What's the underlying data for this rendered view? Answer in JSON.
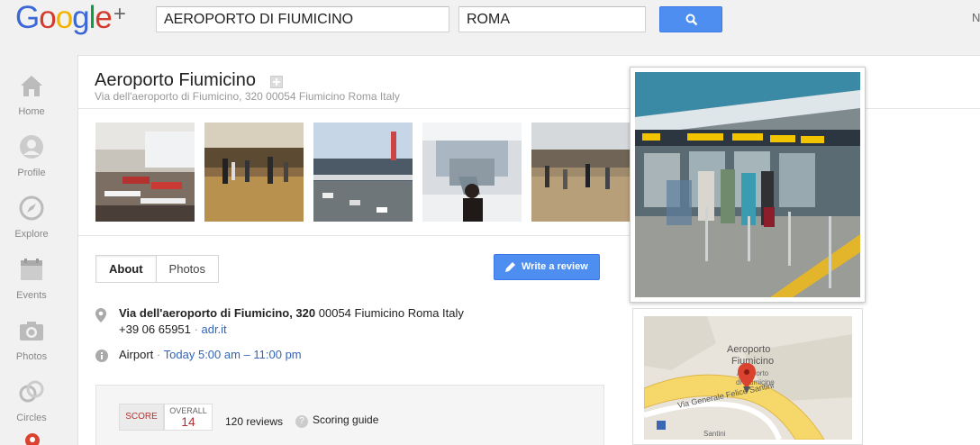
{
  "header": {
    "logo_text": "Google+",
    "search_query": "AEROPORTO DI FIUMICINO",
    "search_location": "ROMA",
    "search_icon": "search-icon",
    "top_right_text": "N"
  },
  "nav": {
    "items": [
      {
        "label": "Home",
        "icon": "home-icon"
      },
      {
        "label": "Profile",
        "icon": "profile-icon"
      },
      {
        "label": "Explore",
        "icon": "compass-icon"
      },
      {
        "label": "Events",
        "icon": "calendar-icon"
      },
      {
        "label": "Photos",
        "icon": "camera-icon"
      },
      {
        "label": "Circles",
        "icon": "circles-icon"
      }
    ]
  },
  "place": {
    "title": "Aeroporto Fiumicino",
    "subtitle": "Via dell'aeroporto di Fiumicino, 320 00054 Fiumicino Roma Italy"
  },
  "tabs": {
    "about": "About",
    "photos": "Photos"
  },
  "actions": {
    "write_review": "Write a review"
  },
  "info": {
    "address_bold": "Via dell'aeroporto di Fiumicino, 320",
    "address_rest": "00054 Fiumicino Roma Italy",
    "phone": "+39 06 65951",
    "separator": "·",
    "website": "adr.it",
    "category": "Airport",
    "hours": "Today 5:00 am – 11:00 pm"
  },
  "score": {
    "label": "SCORE",
    "overall_label": "OVERALL",
    "overall_value": "14",
    "reviews": "120 reviews",
    "guide": "Scoring guide"
  },
  "map": {
    "place_name_line1": "Aeroporto",
    "place_name_line2": "Fiumicino",
    "sub_line1": "Aeroporto",
    "sub_line2": "di Fiumicino",
    "road": "Via Generale Felice Santini",
    "road2": "Santini"
  },
  "colors": {
    "accent_blue": "#4d8ef0",
    "link_blue": "#3465b8",
    "score_red": "#b03434"
  }
}
